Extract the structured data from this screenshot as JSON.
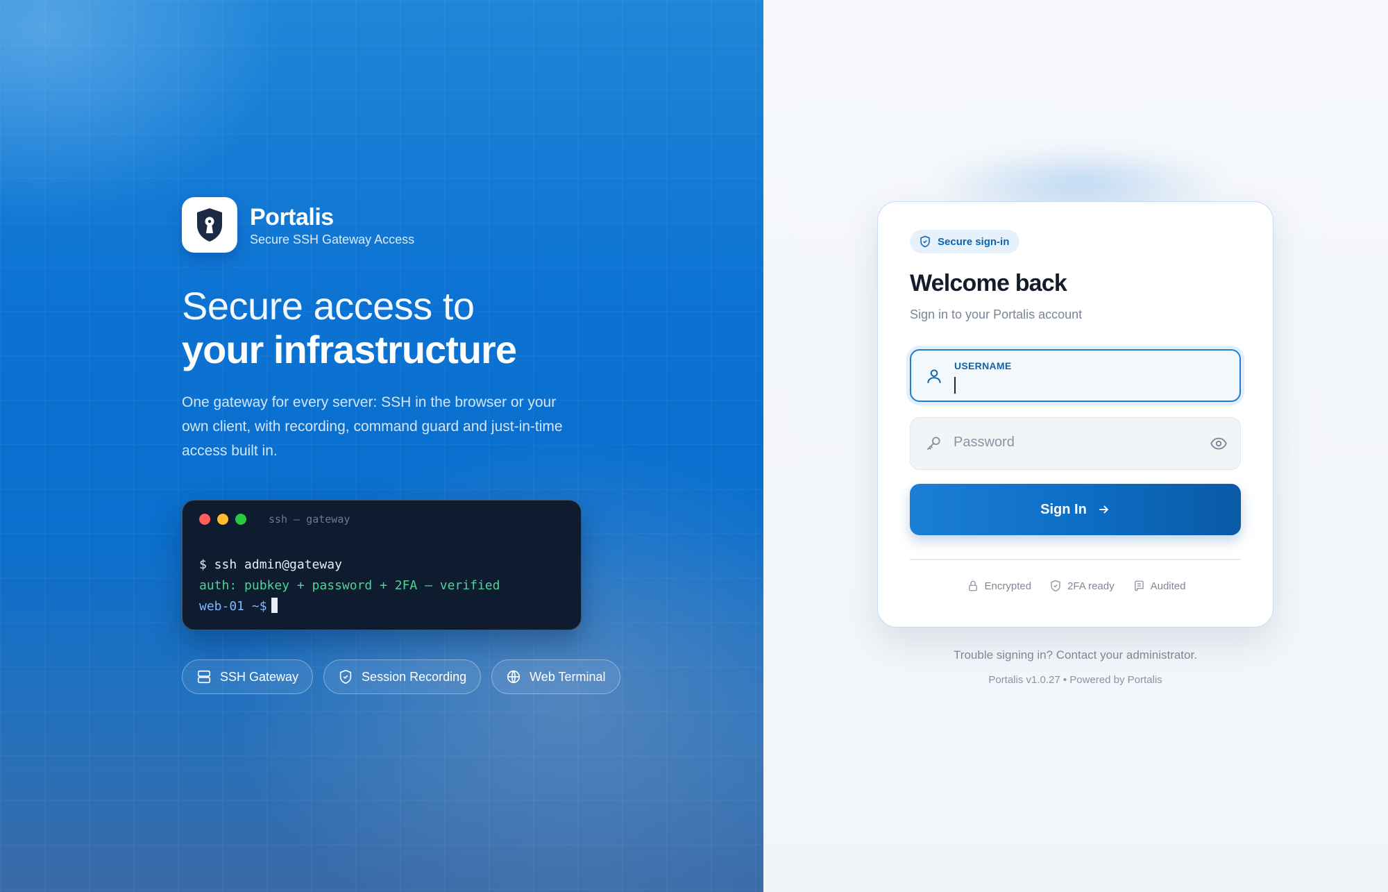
{
  "brand": {
    "name": "Portalis",
    "tagline": "Secure SSH Gateway Access"
  },
  "hero": {
    "headline_line1": "Secure access to",
    "headline_line2": "your infrastructure",
    "description": "One gateway for every server: SSH in the browser or your own client, with recording, command guard and just-in-time access built in."
  },
  "terminal": {
    "title": "ssh — gateway",
    "line1": "$ ssh admin@gateway",
    "line2": "auth: pubkey + password + 2FA — verified",
    "prompt": "web-01 ~$"
  },
  "features": [
    {
      "label": "SSH Gateway",
      "icon": "server-icon"
    },
    {
      "label": "Session Recording",
      "icon": "shield-icon"
    },
    {
      "label": "Web Terminal",
      "icon": "globe-icon"
    }
  ],
  "login": {
    "badge": "Secure sign-in",
    "title": "Welcome back",
    "subtitle": "Sign in to your Portalis account",
    "username_label": "USERNAME",
    "username_value": "",
    "password_placeholder": "Password",
    "submit_label": "Sign In",
    "trust": [
      {
        "label": "Encrypted",
        "icon": "lock-icon"
      },
      {
        "label": "2FA ready",
        "icon": "shield-check-icon"
      },
      {
        "label": "Audited",
        "icon": "scroll-icon"
      }
    ]
  },
  "footer": {
    "help": "Trouble signing in? Contact your administrator.",
    "version": "Portalis v1.0.27 • Powered by Portalis"
  },
  "colors": {
    "primary": "#0d6ec6",
    "hero_bg": "#0a6fcd",
    "terminal_bg": "#0f1b2e",
    "terminal_ok": "#4fd39a",
    "terminal_prompt": "#7fb8ff"
  }
}
